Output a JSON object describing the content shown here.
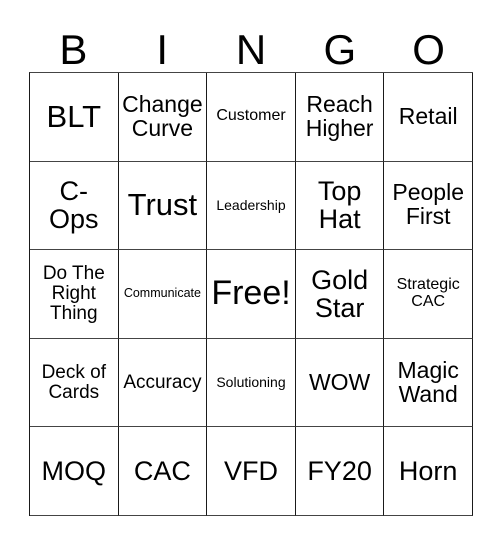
{
  "card": {
    "type": "bingo-card",
    "header_letters": [
      "B",
      "I",
      "N",
      "G",
      "O"
    ],
    "grid_size": "5x5",
    "colors": {
      "background": "#ffffff",
      "text": "#000000",
      "grid_line": "#1a1a1a"
    },
    "rows": [
      [
        {
          "label": "BLT",
          "size": "xl"
        },
        {
          "label": "Change\nCurve",
          "size": "md"
        },
        {
          "label": "Customer",
          "size": "xs"
        },
        {
          "label": "Reach\nHigher",
          "size": "md"
        },
        {
          "label": "Retail",
          "size": "md"
        }
      ],
      [
        {
          "label": "C-\nOps",
          "size": "lg"
        },
        {
          "label": "Trust",
          "size": "xl"
        },
        {
          "label": "Leadership",
          "size": "xxs"
        },
        {
          "label": "Top\nHat",
          "size": "lg"
        },
        {
          "label": "People\nFirst",
          "size": "md"
        }
      ],
      [
        {
          "label": "Do The\nRight\nThing",
          "size": "sm"
        },
        {
          "label": "Communicate",
          "size": "tiny"
        },
        {
          "label": "Free!",
          "size": "xxl"
        },
        {
          "label": "Gold\nStar",
          "size": "lg"
        },
        {
          "label": "Strategic\nCAC",
          "size": "xs"
        }
      ],
      [
        {
          "label": "Deck of\nCards",
          "size": "sm"
        },
        {
          "label": "Accuracy",
          "size": "sm"
        },
        {
          "label": "Solutioning",
          "size": "xxs"
        },
        {
          "label": "WOW",
          "size": "md"
        },
        {
          "label": "Magic\nWand",
          "size": "md"
        }
      ],
      [
        {
          "label": "MOQ",
          "size": "lg"
        },
        {
          "label": "CAC",
          "size": "lg"
        },
        {
          "label": "VFD",
          "size": "lg"
        },
        {
          "label": "FY20",
          "size": "lg"
        },
        {
          "label": "Horn",
          "size": "lg"
        }
      ]
    ]
  }
}
